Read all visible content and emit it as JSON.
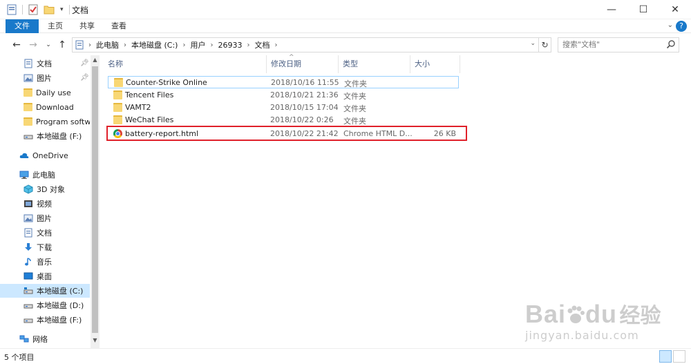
{
  "window": {
    "title": "文档",
    "controls": {
      "minimize": "—",
      "maximize": "☐",
      "close": "✕"
    }
  },
  "ribbon": {
    "tabs": [
      "文件",
      "主页",
      "共享",
      "查看"
    ]
  },
  "address": {
    "crumbs": [
      "此电脑",
      "本地磁盘 (C:)",
      "用户",
      "26933",
      "文档"
    ],
    "search_placeholder": "搜索\"文档\""
  },
  "sidebar": {
    "items": [
      {
        "label": "文档",
        "icon": "documents-icon",
        "pinned": true
      },
      {
        "label": "图片",
        "icon": "pictures-icon",
        "pinned": true
      },
      {
        "label": "Daily use",
        "icon": "folder-icon"
      },
      {
        "label": "Download",
        "icon": "folder-icon"
      },
      {
        "label": "Program softw",
        "icon": "folder-icon"
      },
      {
        "label": "本地磁盘 (F:)",
        "icon": "drive-icon"
      },
      {
        "label": "OneDrive",
        "icon": "onedrive-icon"
      },
      {
        "label": "此电脑",
        "icon": "computer-icon"
      },
      {
        "label": "3D 对象",
        "icon": "3d-objects-icon"
      },
      {
        "label": "视频",
        "icon": "videos-icon"
      },
      {
        "label": "图片",
        "icon": "pictures-icon"
      },
      {
        "label": "文档",
        "icon": "documents-icon"
      },
      {
        "label": "下载",
        "icon": "downloads-icon"
      },
      {
        "label": "音乐",
        "icon": "music-icon"
      },
      {
        "label": "桌面",
        "icon": "desktop-icon"
      },
      {
        "label": "本地磁盘 (C:)",
        "icon": "drive-icon",
        "selected": true
      },
      {
        "label": "本地磁盘 (D:)",
        "icon": "drive-icon"
      },
      {
        "label": "本地磁盘 (F:)",
        "icon": "drive-icon"
      },
      {
        "label": "网络",
        "icon": "network-icon"
      }
    ]
  },
  "columns": {
    "name": "名称",
    "date": "修改日期",
    "type": "类型",
    "size": "大小"
  },
  "files": [
    {
      "name": "Counter-Strike Online",
      "date": "2018/10/16 11:55",
      "type": "文件夹",
      "size": "",
      "icon": "folder-icon"
    },
    {
      "name": "Tencent Files",
      "date": "2018/10/21 21:36",
      "type": "文件夹",
      "size": "",
      "icon": "folder-icon"
    },
    {
      "name": "VAMT2",
      "date": "2018/10/15 17:04",
      "type": "文件夹",
      "size": "",
      "icon": "folder-icon"
    },
    {
      "name": "WeChat Files",
      "date": "2018/10/22 0:26",
      "type": "文件夹",
      "size": "",
      "icon": "folder-icon"
    },
    {
      "name": "battery-report.html",
      "date": "2018/10/22 21:42",
      "type": "Chrome HTML D...",
      "size": "26 KB",
      "icon": "chrome-icon"
    }
  ],
  "status": {
    "count": "5 个项目"
  },
  "watermark": {
    "brand": "Bai",
    "brand2": "du",
    "brand_cn": "经验",
    "url": "jingyan.baidu.com"
  }
}
